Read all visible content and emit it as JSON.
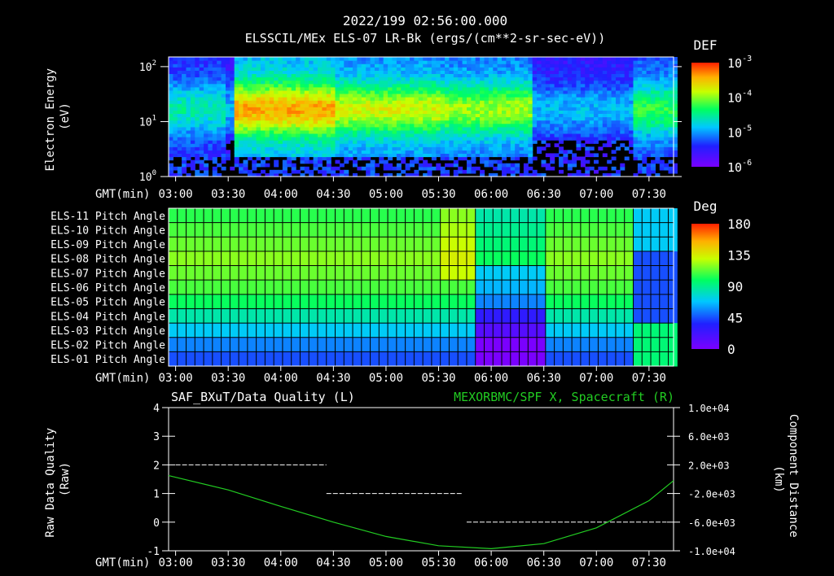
{
  "header": {
    "timestamp": "2022/199 02:56:00.000",
    "instrument": "ELSSCIL/MEx ELS-07 LR-Bk  (ergs/(cm**2-sr-sec-eV))"
  },
  "time_axis": {
    "label": "GMT(min)",
    "ticks": [
      "03:00",
      "03:30",
      "04:00",
      "04:30",
      "05:00",
      "05:30",
      "06:00",
      "06:30",
      "07:00",
      "07:30"
    ]
  },
  "colors": {
    "background": "#000000",
    "foreground": "#ffffff",
    "right_series": "#22cc22"
  },
  "chart_data": [
    {
      "type": "heatmap",
      "ylabel": "Electron Energy\n(eV)",
      "ylim": [
        1,
        150
      ],
      "y_scale": "log",
      "y_ticks": [
        {
          "base": "10",
          "exp": "0"
        },
        {
          "base": "10",
          "exp": "1"
        },
        {
          "base": "10",
          "exp": "2"
        }
      ],
      "colorbar": {
        "title": "DEF",
        "scale": "log",
        "range": [
          1e-06,
          0.001
        ],
        "ticks": [
          {
            "base": "10",
            "exp": "-3"
          },
          {
            "base": "10",
            "exp": "-4"
          },
          {
            "base": "10",
            "exp": "-5"
          },
          {
            "base": "10",
            "exp": "-6"
          }
        ]
      },
      "time_segments": [
        {
          "start": "02:56",
          "end": "03:27",
          "level": 0.45
        },
        {
          "start": "03:27",
          "end": "03:32",
          "level": 0.35
        },
        {
          "start": "03:32",
          "end": "04:30",
          "level": 0.82
        },
        {
          "start": "04:30",
          "end": "05:30",
          "level": 0.7
        },
        {
          "start": "05:30",
          "end": "06:23",
          "level": 0.65
        },
        {
          "start": "06:23",
          "end": "07:20",
          "level": 0.35
        },
        {
          "start": "07:20",
          "end": "07:44",
          "level": 0.55
        }
      ]
    },
    {
      "type": "heatmap",
      "rows": [
        "ELS-11 Pitch Angle",
        "ELS-10 Pitch Angle",
        "ELS-09 Pitch Angle",
        "ELS-08 Pitch Angle",
        "ELS-07 Pitch Angle",
        "ELS-06 Pitch Angle",
        "ELS-05 Pitch Angle",
        "ELS-04 Pitch Angle",
        "ELS-03 Pitch Angle",
        "ELS-02 Pitch Angle",
        "ELS-01 Pitch Angle"
      ],
      "colorbar": {
        "title": "Deg",
        "range": [
          0,
          180
        ],
        "ticks": [
          "180",
          "135",
          "90",
          "45",
          "0"
        ]
      },
      "time_bins_min": 5,
      "row_base_deg": [
        105,
        110,
        115,
        120,
        115,
        110,
        100,
        85,
        70,
        55,
        45
      ]
    },
    {
      "type": "line",
      "title_left": "SAF_BXuT/Data Quality (L)",
      "title_right": "MEXORBMC/SPF X, Spacecraft (R)",
      "ylabel_left": "Raw Data Quality\n(Raw)",
      "ylabel_right": "Component Distance\n(km)",
      "ylim_left": [
        -1,
        4
      ],
      "yticks_left": [
        "4",
        "3",
        "2",
        "1",
        "0",
        "-1"
      ],
      "ylim_right": [
        -10000,
        10000
      ],
      "yticks_right": [
        "1.0e+04",
        "6.0e+03",
        "2.0e+03",
        "-2.0e+03",
        "-6.0e+03",
        "-1.0e+04"
      ],
      "series": [
        {
          "axis": "left",
          "style": "dashed",
          "points": [
            {
              "start": "03:00",
              "end": "04:26",
              "y": 2
            },
            {
              "start": "04:26",
              "end": "05:44",
              "y": 1
            },
            {
              "start": "05:46",
              "end": "07:40",
              "y": 0
            }
          ]
        },
        {
          "axis": "right",
          "x": [
            "02:56",
            "03:30",
            "04:00",
            "04:30",
            "05:00",
            "05:30",
            "06:00",
            "06:30",
            "07:00",
            "07:30",
            "07:44"
          ],
          "y": [
            500,
            -1500,
            -3800,
            -6000,
            -8000,
            -9300,
            -9700,
            -9000,
            -6800,
            -3000,
            -200
          ]
        }
      ]
    }
  ]
}
